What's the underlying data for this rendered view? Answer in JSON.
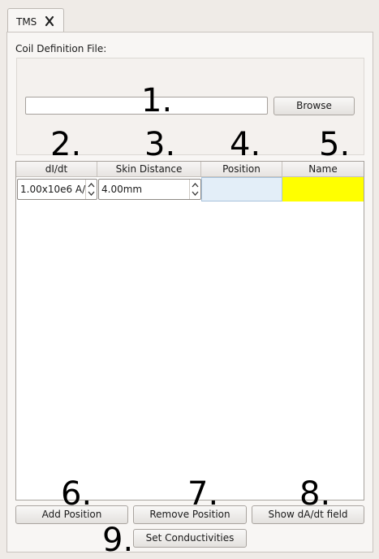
{
  "tab": {
    "label": "TMS",
    "close_icon": "close-x-icon"
  },
  "coil": {
    "label": "Coil Definition File:",
    "file_value": "",
    "browse_label": "Browse"
  },
  "table": {
    "headers": [
      "dI/dt",
      "Skin Distance",
      "Position",
      "Name"
    ],
    "rows": [
      {
        "didt": "1.00x10e6 A/",
        "skin_distance": "4.00mm",
        "position": "",
        "name": ""
      }
    ]
  },
  "buttons": {
    "add_position": "Add Position",
    "remove_position": "Remove Position",
    "show_field": "Show dA/dt field",
    "set_conductivities": "Set Conductivities"
  },
  "annotations": [
    "1.",
    "2.",
    "3.",
    "4.",
    "5.",
    "6.",
    "7.",
    "8.",
    "9."
  ],
  "colors": {
    "name_cell": "#ffff00",
    "position_cell": "#e3eef8"
  }
}
